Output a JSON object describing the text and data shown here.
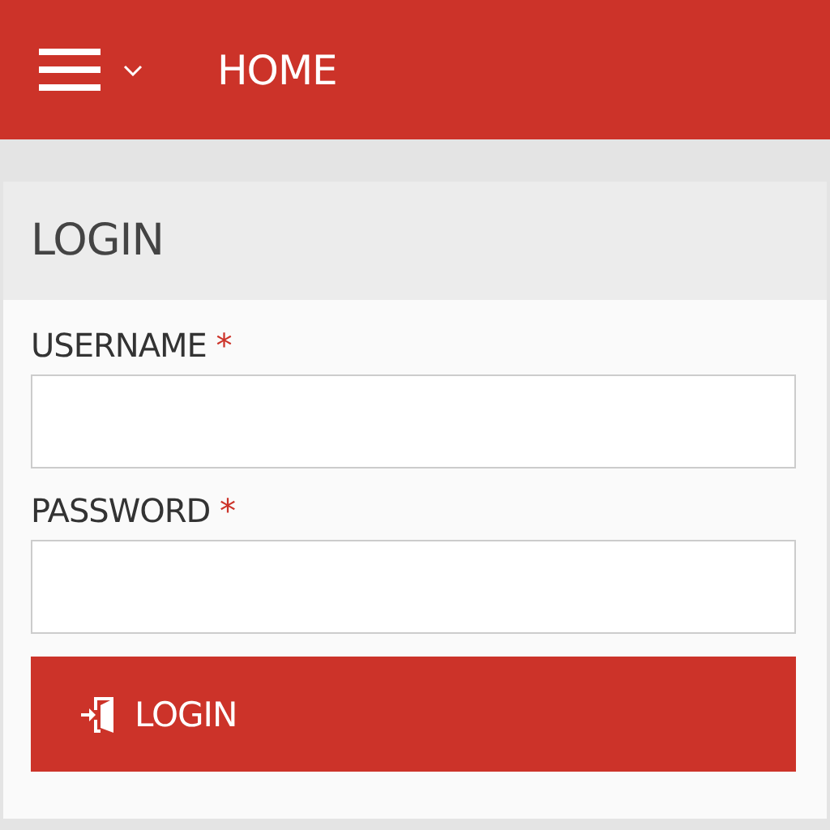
{
  "header": {
    "title": "HOME"
  },
  "login": {
    "title": "LOGIN",
    "fields": [
      {
        "label": "USERNAME",
        "required_mark": "*"
      },
      {
        "label": "PASSWORD",
        "required_mark": "*"
      }
    ],
    "button": "LOGIN"
  }
}
